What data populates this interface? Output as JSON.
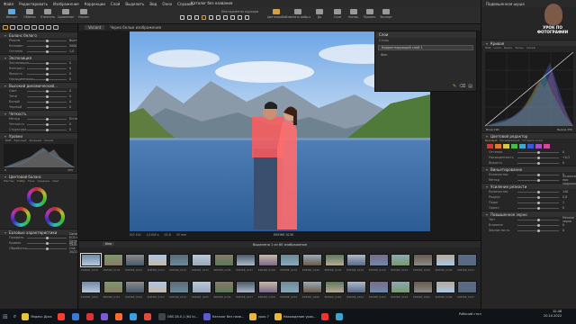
{
  "window": {
    "title": "Каталог без названия",
    "menu": [
      "Файл",
      "Редактировать",
      "Изображение",
      "Коррекции",
      "Слой",
      "Выделить",
      "Вид",
      "Окно",
      "Справка"
    ]
  },
  "toolbar": {
    "left": [
      {
        "label": "Импорт",
        "icon": "import-icon",
        "color": "#5fa8e0"
      },
      {
        "label": "Обмены",
        "icon": "exchange-icon",
        "color": "#999"
      },
      {
        "label": "Отменить",
        "icon": "undo-icon",
        "color": "#999"
      },
      {
        "label": "Сравнение",
        "icon": "compare-icon",
        "color": "#999"
      },
      {
        "label": "Управл",
        "icon": "manage-icon",
        "color": "#999"
      }
    ],
    "tools_label": "Инструменты курсора",
    "right": [
      {
        "label": "Цветопроба",
        "icon": "proof-icon",
        "color": "#d4a04a"
      },
      {
        "label": "Изменить выбр.о",
        "icon": "edit-icon",
        "color": "#999"
      },
      {
        "label": "До",
        "icon": "before-icon",
        "color": "#999"
      },
      {
        "label": "Слои",
        "icon": "layers-icon",
        "color": "#999"
      },
      {
        "label": "Копир.",
        "icon": "copy-icon",
        "color": "#999"
      },
      {
        "label": "Примен.",
        "icon": "apply-icon",
        "color": "#999"
      },
      {
        "label": "Экспорт",
        "icon": "export-icon",
        "color": "#999"
      }
    ],
    "search_placeholder": "Поиск"
  },
  "left_panel": {
    "white_balance": {
      "title": "Баланс белого",
      "rows": [
        {
          "label": "Режим",
          "value": "Выстав."
        },
        {
          "label": "Кельвин",
          "value": "5000"
        },
        {
          "label": "Оттенок",
          "value": "1,0"
        }
      ]
    },
    "exposure": {
      "title": "Экспозиция",
      "rows": [
        {
          "label": "Экспозиция",
          "value": "0"
        },
        {
          "label": "Контраст",
          "value": "0"
        },
        {
          "label": "Яркость",
          "value": "0"
        },
        {
          "label": "Насыщенность",
          "value": "0"
        }
      ]
    },
    "hdr": {
      "title": "Высокий динамический...",
      "rows": [
        {
          "label": "Свет",
          "value": "0"
        },
        {
          "label": "Тени",
          "value": "0"
        },
        {
          "label": "Белый",
          "value": "0"
        },
        {
          "label": "Черный",
          "value": "0"
        }
      ]
    },
    "clarity": {
      "title": "Четкость",
      "rows": [
        {
          "label": "Метод",
          "value": "Естественный"
        },
        {
          "label": "Четкость",
          "value": "0"
        },
        {
          "label": "Структура",
          "value": "0"
        }
      ]
    },
    "levels": {
      "title": "Уровни",
      "tabs": [
        "RGB",
        "Красный",
        "Зеленый",
        "Синий"
      ],
      "low": "0",
      "high": "255"
    },
    "color_balance": {
      "title": "Цветовой баланс",
      "tabs": [
        "Мастер",
        "3-Way",
        "Тени",
        "Средние",
        "Свет"
      ]
    },
    "base": {
      "title": "Базовые характеристики",
      "rows": [
        {
          "label": "Профиль",
          "value": "Canon EOS 6D Generic"
        },
        {
          "label": "Кривая",
          "value": "Авто"
        },
        {
          "label": "Обработка",
          "value": "Capture One 20/21"
        }
      ]
    }
  },
  "viewer": {
    "variant_label": "Variant",
    "header_text": "Черно белые изображения",
    "meta": [
      "ISO 100",
      "1/1000 s",
      "f/2.8",
      "35 mm"
    ],
    "filename": "ЕКЕЖЕ 0130",
    "page_info": "1/60"
  },
  "layers_panel": {
    "title": "Слои",
    "preset_label": "Стиль",
    "layer_name": "Фон",
    "adjustment": "Корректирующий слой 1",
    "fill": "Заливка",
    "opacity": "100"
  },
  "right_panel": {
    "camera_name": "Подвешенная шуша",
    "badge_line1": "УРОК ПО",
    "badge_line2": "ФОТОГРАФИИ",
    "histogram_label": "Гистограмма",
    "exposure_eval": {
      "rows": [
        {
          "label": "Выдержка",
          "value": "0"
        },
        {
          "label": "Свет",
          "value": "0"
        },
        {
          "label": "Тени",
          "value": "0"
        }
      ]
    },
    "curve": {
      "title": "Кривая",
      "tabs": [
        "RGB",
        "Luma",
        "Красн",
        "Зелен",
        "Синий"
      ],
      "input": "Вход 196",
      "output": "Выход 255"
    },
    "color_editor": {
      "title": "Цветовой редактор",
      "tabs": [
        "Базовый",
        "Расширенный",
        "Оттенок кожи"
      ],
      "swatches": [
        "#d23a3a",
        "#e07a30",
        "#d8c83a",
        "#4ab84a",
        "#3aaad0",
        "#3a5ad8",
        "#b04ad0",
        "#d04a9a"
      ],
      "rows": [
        {
          "label": "Оттенок",
          "value": "0"
        },
        {
          "label": "Насыщенность",
          "value": "+0,3"
        },
        {
          "label": "Яркость",
          "value": "0"
        }
      ]
    },
    "vignette": {
      "title": "Виньетирование",
      "rows": [
        {
          "label": "Количество",
          "value": "0"
        },
        {
          "label": "Метод",
          "value": "Эллиптическое при кадрировании"
        }
      ]
    },
    "noise": {
      "title": "Усиление резкости",
      "rows": [
        {
          "label": "Количество",
          "value": "140"
        },
        {
          "label": "Радиус",
          "value": "0,8"
        },
        {
          "label": "Порог",
          "value": "1"
        },
        {
          "label": "Ореол",
          "value": "0"
        }
      ]
    },
    "film_grain": {
      "title": "Повышенное зерно",
      "rows": [
        {
          "label": "Тип",
          "value": "Мелкое зерно"
        },
        {
          "label": "Влияние",
          "value": "0"
        },
        {
          "label": "Зернистость",
          "value": "0"
        }
      ]
    }
  },
  "filmstrip": {
    "header": "Выделено 1 из 60 изображение",
    "sort": "Имя",
    "row1_labels": [
      "ЕКЕЖЕ_0130",
      "ЕКЕЖЕ_0131",
      "ЕКЕЖЕ_0132",
      "ЕКЕЖЕ_0133",
      "ЕКЕЖЕ_0134",
      "ЕКЕЖЕ_0135",
      "ЕКЕЖЕ_0136",
      "ЕКЕЖЕ_0137",
      "ЕКЕЖЕ_0138",
      "ЕКЕЖЕ_0139",
      "ЕКЕЖЕ_0140",
      "ЕКЕЖЕ_0141",
      "ЕКЕЖЕ_0142",
      "ЕКЕЖЕ_0143",
      "ЕКЕЖЕ_0144",
      "ЕКЕЖЕ_0145",
      "ЕКЕЖЕ_0146",
      "ЕКЕЖЕ_0147"
    ],
    "row2_labels": [
      "ЕКЕЖЕ_0150",
      "ЕКЕЖЕ_0151",
      "ЕКЕЖЕ_0152",
      "ЕКЕЖЕ_0153",
      "ЕКЕЖЕ_0154",
      "ЕКЕЖЕ_0155",
      "ЕКЕЖЕ_0156",
      "ЕКЕЖЕ_0157",
      "ЕКЕЖЕ_0158",
      "ЕКЕЖЕ_0159",
      "ЕКЕЖЕ_0160",
      "ЕКЕЖЕ_0161",
      "ЕКЕЖЕ_0162",
      "ЕКЕЖЕ_0163",
      "ЕКЕЖЕ_0164",
      "ЕКЕЖЕ_0165",
      "ЕКЕЖЕ_0166",
      "ЕКЕЖЕ_0167"
    ]
  },
  "taskbar": {
    "items": [
      {
        "label": "Яндекс Диск",
        "color": "#e8c33a"
      },
      {
        "label": "",
        "color": "#ff3b30"
      },
      {
        "label": "",
        "color": "#3a7bd5"
      },
      {
        "label": "",
        "color": "#d33"
      },
      {
        "label": "",
        "color": "#7a5ad0"
      },
      {
        "label": "",
        "color": "#ff6a2a"
      },
      {
        "label": "",
        "color": "#3aa0e0"
      },
      {
        "label": "",
        "color": "#e34a3a"
      },
      {
        "label": "OBS 28.0.1 (64 bi...",
        "color": "#444"
      },
      {
        "label": "Каталог без назв...",
        "color": "#5a5ad0"
      },
      {
        "label": "урок 7",
        "color": "#e8b83a"
      },
      {
        "label": "Нахождение урок...",
        "color": "#e8b83a"
      },
      {
        "label": "",
        "color": "#e33"
      },
      {
        "label": "",
        "color": "#3ac"
      }
    ],
    "desktop": "Рабочий стол",
    "time": "12:48",
    "date": "20.10.2022"
  }
}
